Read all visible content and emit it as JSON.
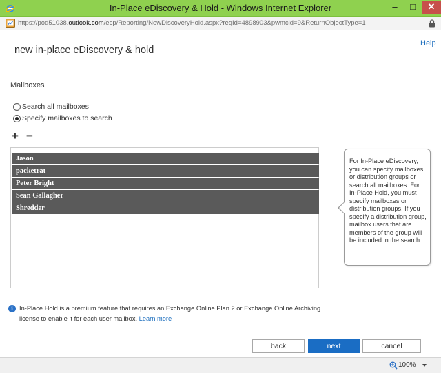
{
  "window": {
    "title": "In-Place eDiscovery & Hold - Windows Internet Explorer",
    "minimize": "–",
    "maximize": "□",
    "close": "✕"
  },
  "address": {
    "url_prefix": "https://pod51038.",
    "url_domain": "outlook.com",
    "url_suffix": "/ecp/Reporting/NewDiscoveryHold.aspx?reqId=4898903&pwmcid=9&ReturnObjectType=1"
  },
  "header": {
    "help": "Help",
    "title": "new in-place eDiscovery & hold"
  },
  "mailboxes": {
    "label": "Mailboxes",
    "option_all": "Search all mailboxes",
    "option_specify": "Specify mailboxes to search",
    "selected_option": "Specify mailboxes to search",
    "add": "+",
    "remove": "−",
    "items": [
      "Jason",
      "packetrat",
      "Peter Bright",
      "Sean Gallagher",
      "Shredder"
    ]
  },
  "callout": {
    "text": "For In-Place eDiscovery, you can specify mailboxes or distribution groups or search all mailboxes. For In-Place Hold, you must specify mailboxes or distribution groups. If you specify a distribution group, mailbox users that are members of the group will be included in the search."
  },
  "info": {
    "icon": "i",
    "text": "In-Place Hold is a premium feature that requires an Exchange Online Plan 2 or Exchange Online Archiving license to enable it for each user mailbox.",
    "link": "Learn more"
  },
  "buttons": {
    "back": "back",
    "next": "next",
    "cancel": "cancel"
  },
  "status": {
    "zoom": "100%"
  },
  "colors": {
    "titlebar": "#8fd14f",
    "accent": "#1a6dc4",
    "list_row": "#5a5a5a",
    "link": "#1e6fbe"
  }
}
